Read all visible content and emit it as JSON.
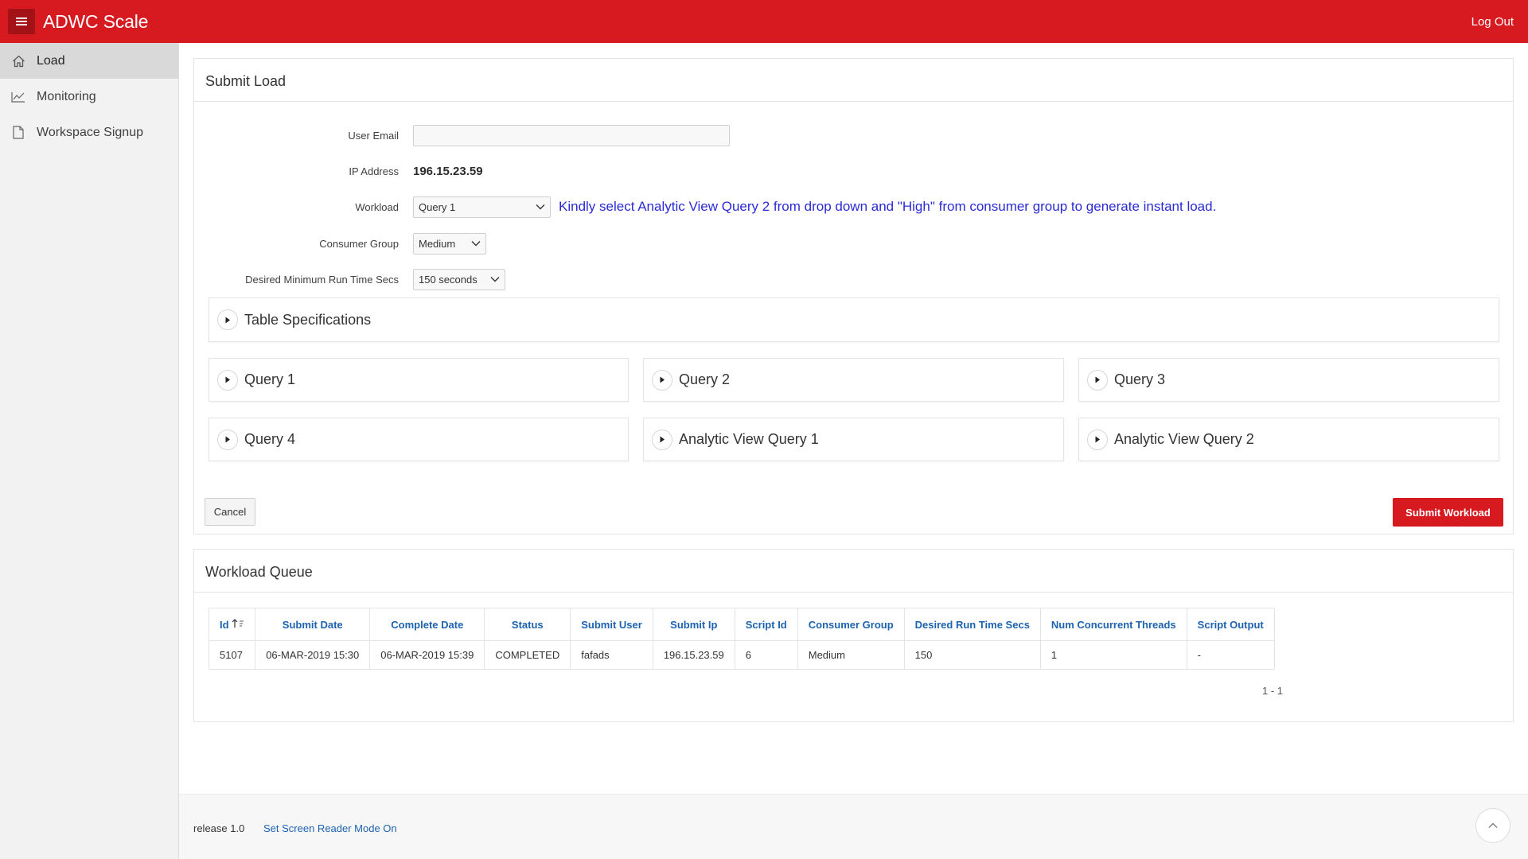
{
  "header": {
    "app_title": "ADWC Scale",
    "logout_label": "Log Out",
    "menu_icon": "hamburger-icon",
    "brand_color": "#d71a20"
  },
  "sidebar": {
    "items": [
      {
        "label": "Load",
        "icon": "home-icon",
        "active": true
      },
      {
        "label": "Monitoring",
        "icon": "chart-icon",
        "active": false
      },
      {
        "label": "Workspace Signup",
        "icon": "document-icon",
        "active": false
      }
    ]
  },
  "submit_load": {
    "title": "Submit Load",
    "user_email": {
      "label": "User Email",
      "value": ""
    },
    "ip_address": {
      "label": "IP Address",
      "value": "196.15.23.59"
    },
    "workload": {
      "label": "Workload",
      "value": "Query 1"
    },
    "hint": "Kindly select Analytic View Query 2 from drop down and \"High\" from consumer group to generate instant load.",
    "consumer_group": {
      "label": "Consumer Group",
      "value": "Medium"
    },
    "run_time": {
      "label": "Desired Minimum Run Time Secs",
      "value": "150 seconds"
    },
    "table_specifications": "Table Specifications",
    "queries": [
      "Query 1",
      "Query 2",
      "Query 3",
      "Query 4",
      "Analytic View Query 1",
      "Analytic View Query 2"
    ],
    "cancel_label": "Cancel",
    "submit_label": "Submit Workload"
  },
  "workload_queue": {
    "title": "Workload Queue",
    "columns": [
      "Id",
      "Submit Date",
      "Complete Date",
      "Status",
      "Submit User",
      "Submit Ip",
      "Script Id",
      "Consumer Group",
      "Desired Run Time Secs",
      "Num Concurrent Threads",
      "Script Output"
    ],
    "rows": [
      [
        "5107",
        "06-MAR-2019 15:30",
        "06-MAR-2019 15:39",
        "COMPLETED",
        "fafads",
        "196.15.23.59",
        "6",
        "Medium",
        "150",
        "1",
        "-"
      ]
    ],
    "pagination": "1 - 1"
  },
  "footer": {
    "release": "release 1.0",
    "screen_reader": "Set Screen Reader Mode On"
  }
}
